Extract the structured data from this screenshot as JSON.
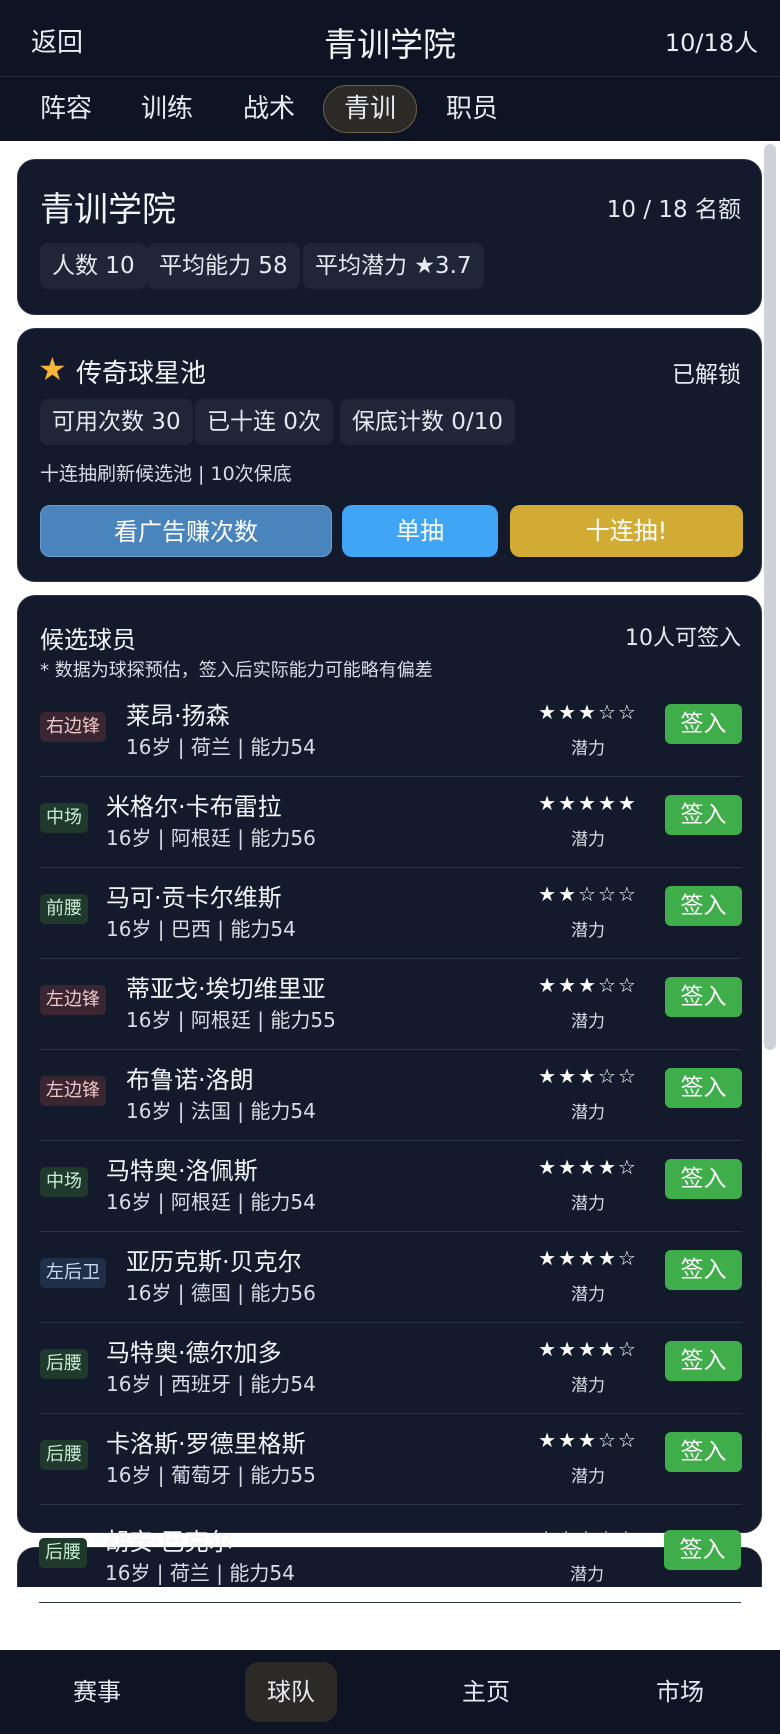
{
  "header": {
    "back_label": "返回",
    "title": "青训学院",
    "count": "10/18人"
  },
  "tabs": [
    {
      "label": "阵容",
      "active": false
    },
    {
      "label": "训练",
      "active": false
    },
    {
      "label": "战术",
      "active": false
    },
    {
      "label": "青训",
      "active": true
    },
    {
      "label": "职员",
      "active": false
    }
  ],
  "academy": {
    "title": "青训学院",
    "quota": "10 / 18 名额",
    "stats": [
      "人数 10",
      "平均能力 58",
      "平均潜力 ★3.7"
    ]
  },
  "pool": {
    "icon": "star-icon",
    "title": "传奇球星池",
    "status": "已解锁",
    "stats": [
      "可用次数 30",
      "已十连 0次",
      "保底计数 0/10"
    ],
    "note": "十连抽刷新候选池 | 10次保底",
    "buttons": {
      "ad": "看广告赚次数",
      "single": "单抽",
      "ten": "十连抽!"
    }
  },
  "candidates": {
    "title": "候选球员",
    "count": "10人可签入",
    "disclaimer": "* 数据为球探预估，签入后实际能力可能略有偏差",
    "potential_label": "潜力",
    "sign_label": "签入",
    "players": [
      {
        "position": "右边锋",
        "name": "莱昂·扬森",
        "info": "16岁 | 荷兰 | 能力54",
        "stars": "★★★☆☆"
      },
      {
        "position": "中场",
        "name": "米格尔·卡布雷拉",
        "info": "16岁 | 阿根廷 | 能力56",
        "stars": "★★★★★"
      },
      {
        "position": "前腰",
        "name": "马可·贡卡尔维斯",
        "info": "16岁 | 巴西 | 能力54",
        "stars": "★★☆☆☆"
      },
      {
        "position": "左边锋",
        "name": "蒂亚戈·埃切维里亚",
        "info": "16岁 | 阿根廷 | 能力55",
        "stars": "★★★☆☆"
      },
      {
        "position": "左边锋",
        "name": "布鲁诺·洛朗",
        "info": "16岁 | 法国 | 能力54",
        "stars": "★★★☆☆"
      },
      {
        "position": "中场",
        "name": "马特奥·洛佩斯",
        "info": "16岁 | 阿根廷 | 能力54",
        "stars": "★★★★☆"
      },
      {
        "position": "左后卫",
        "name": "亚历克斯·贝克尔",
        "info": "16岁 | 德国 | 能力56",
        "stars": "★★★★☆"
      },
      {
        "position": "后腰",
        "name": "马特奥·德尔加多",
        "info": "16岁 | 西班牙 | 能力54",
        "stars": "★★★★☆"
      },
      {
        "position": "后腰",
        "name": "卡洛斯·罗德里格斯",
        "info": "16岁 | 葡萄牙 | 能力55",
        "stars": "★★★☆☆"
      },
      {
        "position": "后腰",
        "name": "胡安·巴克尔",
        "info": "16岁 | 荷兰 | 能力54",
        "stars": "★★☆☆☆"
      }
    ]
  },
  "bottom_nav": [
    {
      "label": "赛事",
      "active": false
    },
    {
      "label": "球队",
      "active": true
    },
    {
      "label": "主页",
      "active": false
    },
    {
      "label": "市场",
      "active": false
    }
  ]
}
